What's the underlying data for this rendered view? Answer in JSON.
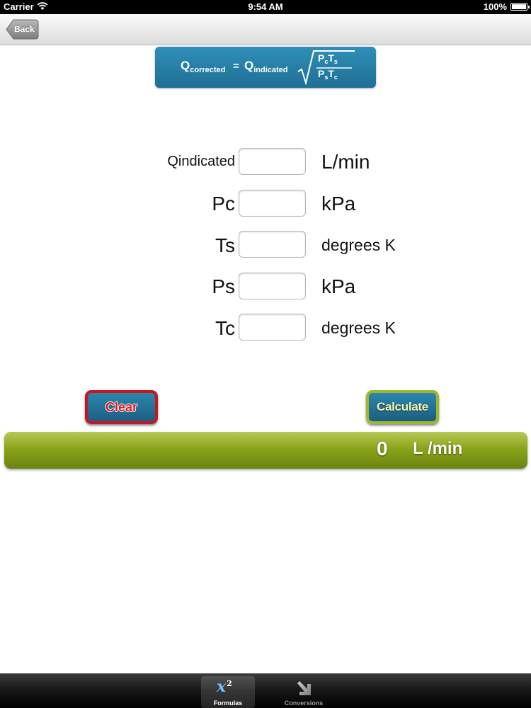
{
  "status_bar": {
    "carrier": "Carrier",
    "time": "9:54 AM",
    "battery": "100%"
  },
  "nav": {
    "back_label": "Back"
  },
  "formula": {
    "q": "Q",
    "corrected": "corrected",
    "equals": "=",
    "indicated": "indicated",
    "num_p": "P",
    "num_p_sub": "c",
    "num_t": "T",
    "num_t_sub": "s",
    "den_p": "P",
    "den_p_sub": "s",
    "den_t": "T",
    "den_t_sub": "c"
  },
  "inputs": [
    {
      "label": "Qindicated",
      "value": "",
      "unit": "L/min"
    },
    {
      "label": "Pc",
      "value": "",
      "unit": "kPa"
    },
    {
      "label": "Ts",
      "value": "",
      "unit": "degrees K"
    },
    {
      "label": "Ps",
      "value": "",
      "unit": "kPa"
    },
    {
      "label": "Tc",
      "value": "",
      "unit": "degrees K"
    }
  ],
  "buttons": {
    "clear": "Clear",
    "calculate": "Calculate"
  },
  "result": {
    "value": "0",
    "unit": "L /min"
  },
  "tabs": [
    {
      "label": "Formulas",
      "icon": "x-squared-icon",
      "active": true
    },
    {
      "label": "Conversions",
      "icon": "arrow-down-right-icon",
      "active": false
    }
  ],
  "colors": {
    "accent_blue": "#1f6f95",
    "result_green": "#8aa419",
    "clear_red": "#c8161e",
    "calc_green": "#a0b62b"
  }
}
